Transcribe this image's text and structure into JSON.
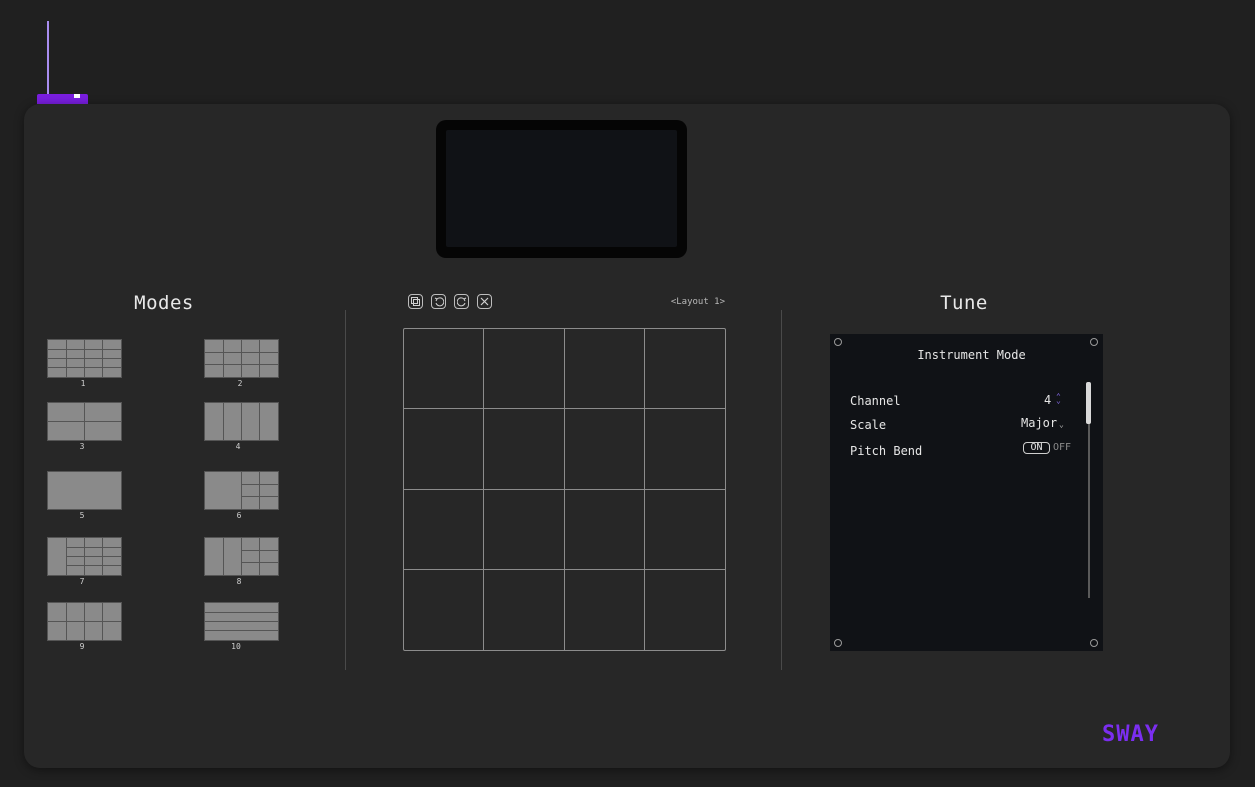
{
  "modes": {
    "title": "Modes",
    "items": [
      {
        "number": "1"
      },
      {
        "number": "2"
      },
      {
        "number": "3"
      },
      {
        "number": "4"
      },
      {
        "number": "5"
      },
      {
        "number": "6"
      },
      {
        "number": "7"
      },
      {
        "number": "8"
      },
      {
        "number": "9"
      },
      {
        "number": "10"
      }
    ]
  },
  "editor": {
    "layout_name": "<Layout 1>",
    "toolbar": [
      "copy-icon",
      "undo-icon",
      "redo-icon",
      "close-icon"
    ]
  },
  "tune": {
    "title": "Tune",
    "panel_title": "Instrument Mode",
    "channel_label": "Channel",
    "channel_value": "4",
    "scale_label": "Scale",
    "scale_value": "Major",
    "pitch_bend_label": "Pitch Bend",
    "pitch_bend_on": "ON",
    "pitch_bend_off": "OFF"
  },
  "brand": "SWAY",
  "colors": {
    "accent": "#7a1ee0",
    "background": "#202020",
    "device": "#272727"
  }
}
